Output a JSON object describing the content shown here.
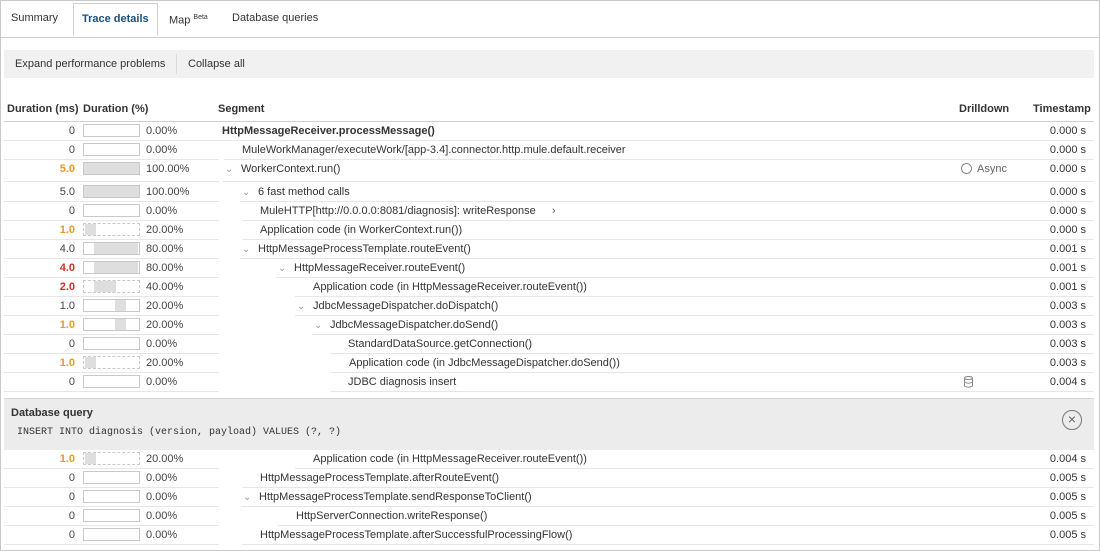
{
  "tabs": [
    {
      "label": "Summary"
    },
    {
      "label": "Trace details"
    },
    {
      "label": "Map",
      "sup": "Beta"
    },
    {
      "label": "Database queries"
    }
  ],
  "toolbar": {
    "expand_label": "Expand performance problems",
    "collapse_label": "Collapse all"
  },
  "headers": {
    "duration_ms": "Duration (ms)",
    "duration_pct": "Duration (%)",
    "segment": "Segment",
    "drilldown": "Drilldown",
    "timestamp": "Timestamp"
  },
  "rows": [
    {
      "ms": "0",
      "pct": "0.00%",
      "fill": 0,
      "segment": "HttpMessageReceiver.processMessage()",
      "bold": true,
      "ts": "0.000 s"
    },
    {
      "ms": "0",
      "pct": "0.00%",
      "fill": 0,
      "segment": "MuleWorkManager/executeWork/[app-3.4].connector.http.mule.default.receiver",
      "ts": "0.000 s"
    },
    {
      "ms": "5.0",
      "pct": "100.00%",
      "fill": 100,
      "segment": "WorkerContext.run()",
      "ms_color": "orange",
      "chevron": true,
      "drill": "Async",
      "ts": "0.000 s"
    },
    {
      "ms": "5.0",
      "pct": "100.00%",
      "fill": 100,
      "segment": "6 fast method calls",
      "chevron": true,
      "ts": "0.000 s"
    },
    {
      "ms": "0",
      "pct": "0.00%",
      "fill": 0,
      "segment": "MuleHTTP[http://0.0.0.0:8081/diagnosis]: writeResponse",
      "arrow": "›",
      "ts": "0.000 s"
    },
    {
      "ms": "1.0",
      "pct": "20.00%",
      "fill": 20,
      "segment": "Application code (in WorkerContext.run())",
      "ms_color": "orange",
      "dashed": true,
      "ts": "0.000 s"
    },
    {
      "ms": "4.0",
      "pct": "80.00%",
      "fill": 80,
      "segment": "HttpMessageProcessTemplate.routeEvent()",
      "chevron": true,
      "ts": "0.001 s"
    },
    {
      "ms": "4.0",
      "pct": "80.00%",
      "fill": 80,
      "segment": "HttpMessageReceiver.routeEvent()",
      "ms_color": "red",
      "chevron": true,
      "ts": "0.001 s"
    },
    {
      "ms": "2.0",
      "pct": "40.00%",
      "fill": 40,
      "segment": "Application code (in HttpMessageReceiver.routeEvent())",
      "ms_color": "red",
      "dashed": true,
      "ts": "0.001 s"
    },
    {
      "ms": "1.0",
      "pct": "20.00%",
      "fill": 20,
      "segment": "JdbcMessageDispatcher.doDispatch()",
      "chevron": true,
      "ts": "0.003 s"
    },
    {
      "ms": "1.0",
      "pct": "20.00%",
      "fill": 20,
      "segment": "JdbcMessageDispatcher.doSend()",
      "ms_color": "orange",
      "chevron": true,
      "ts": "0.003 s"
    },
    {
      "ms": "0",
      "pct": "0.00%",
      "fill": 0,
      "segment": "StandardDataSource.getConnection()",
      "ts": "0.003 s"
    },
    {
      "ms": "1.0",
      "pct": "20.00%",
      "fill": 20,
      "segment": "Application code (in JdbcMessageDispatcher.doSend())",
      "ms_color": "orange",
      "dashed": true,
      "ts": "0.003 s"
    },
    {
      "ms": "0",
      "pct": "0.00%",
      "fill": 0,
      "segment": "JDBC diagnosis insert",
      "db": true,
      "ts": "0.004 s"
    }
  ],
  "db_panel": {
    "title": "Database query",
    "sql": "INSERT INTO diagnosis (version, payload) VALUES (?, ?)",
    "close_icon": "close-circle-icon"
  },
  "rows2": [
    {
      "ms": "1.0",
      "pct": "20.00%",
      "fill": 20,
      "segment": "Application code (in HttpMessageReceiver.routeEvent())",
      "ms_color": "orange",
      "dashed": true,
      "ts": "0.004 s"
    },
    {
      "ms": "0",
      "pct": "0.00%",
      "fill": 0,
      "segment": "HttpMessageProcessTemplate.afterRouteEvent()",
      "ts": "0.005 s"
    },
    {
      "ms": "0",
      "pct": "0.00%",
      "fill": 0,
      "segment": "HttpMessageProcessTemplate.sendResponseToClient()",
      "chevron": true,
      "ts": "0.005 s"
    },
    {
      "ms": "0",
      "pct": "0.00%",
      "fill": 0,
      "segment": "HttpServerConnection.writeResponse()",
      "ts": "0.005 s"
    },
    {
      "ms": "0",
      "pct": "0.00%",
      "fill": 0,
      "segment": "HttpMessageProcessTemplate.afterSuccessfulProcessingFlow()",
      "ts": "0.005 s"
    }
  ],
  "colors": {
    "orange": "#e59a2a",
    "red": "#c9312a",
    "active_tab": "#1b4f7a"
  }
}
